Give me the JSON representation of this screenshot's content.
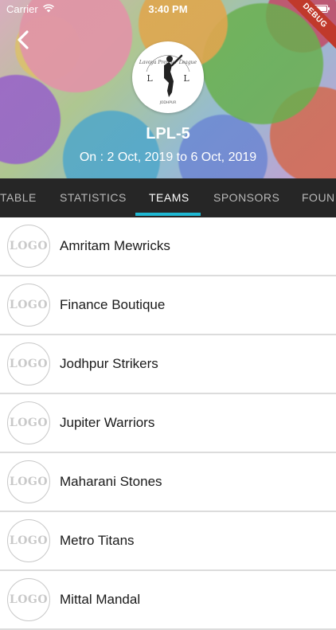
{
  "status_bar": {
    "carrier": "Carrier",
    "time": "3:40 PM"
  },
  "debug_label": "DEBUG",
  "league": {
    "name": "LPL-5",
    "dates": "On : 2 Oct, 2019 to 6 Oct, 2019",
    "logo_text": {
      "initials_left": "L",
      "initials_center": "P",
      "initials_right": "L",
      "top_text": "Lavoya Premier League",
      "bottom_text": "JODHPUR"
    }
  },
  "tabs": [
    {
      "label": "TABLE",
      "active": false
    },
    {
      "label": "STATISTICS",
      "active": false
    },
    {
      "label": "TEAMS",
      "active": true
    },
    {
      "label": "SPONSORS",
      "active": false
    },
    {
      "label": "FOUN",
      "active": false
    }
  ],
  "teams": [
    {
      "logo_placeholder": "LOGO",
      "name": "Amritam Mewricks"
    },
    {
      "logo_placeholder": "LOGO",
      "name": "Finance Boutique"
    },
    {
      "logo_placeholder": "LOGO",
      "name": "Jodhpur Strikers"
    },
    {
      "logo_placeholder": "LOGO",
      "name": "Jupiter Warriors"
    },
    {
      "logo_placeholder": "LOGO",
      "name": "Maharani Stones"
    },
    {
      "logo_placeholder": "LOGO",
      "name": "Metro Titans"
    },
    {
      "logo_placeholder": "LOGO",
      "name": "Mittal Mandal"
    }
  ],
  "colors": {
    "tab_bar": "#262626",
    "tab_indicator": "#1fb8d3",
    "debug_banner": "#c0392b"
  }
}
